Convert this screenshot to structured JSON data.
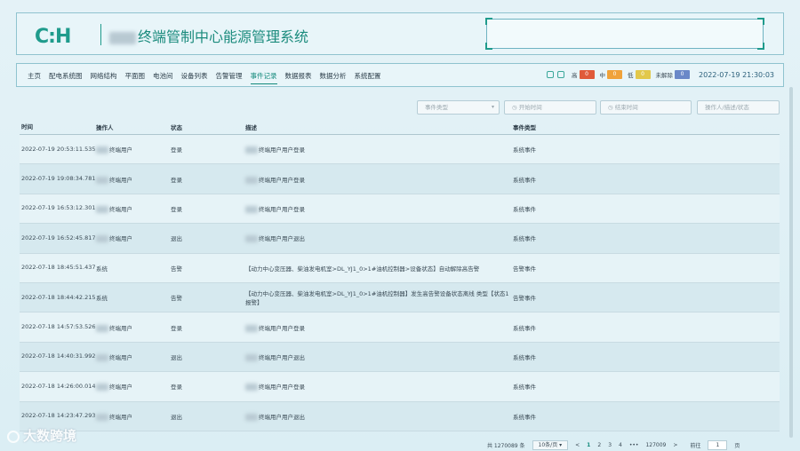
{
  "header": {
    "logo": "C:H",
    "title": "终端管制中心能源管理系统"
  },
  "nav": {
    "items": [
      "主页",
      "配电系统图",
      "网络结构",
      "平面图",
      "电池间",
      "设备列表",
      "告警管理",
      "事件记录",
      "数据报表",
      "数据分析",
      "系统配置"
    ],
    "active_index": 7
  },
  "status": {
    "levels": [
      {
        "label": "高",
        "count": "0",
        "color": "#e05a3a"
      },
      {
        "label": "中",
        "count": "0",
        "color": "#f0a23a"
      },
      {
        "label": "低",
        "count": "0",
        "color": "#e2c84a"
      },
      {
        "label": "未解除",
        "count": "0",
        "color": "#6a88c8"
      }
    ],
    "datetime": "2022-07-19 21:30:03"
  },
  "filters": {
    "event_type": "事件类型",
    "start_time": "开始时间",
    "end_time": "结束时间",
    "search": "操作人/描述/状态"
  },
  "table": {
    "headers": [
      "时间",
      "操作人",
      "状态",
      "描述",
      "事件类型"
    ],
    "rows": [
      {
        "time": "2022-07-19 20:53:11.535",
        "operator": "终端用户",
        "status": "登录",
        "desc": "终端用户用户登录",
        "type": "系统事件",
        "blur_op": true,
        "blur_desc": true
      },
      {
        "time": "2022-07-19 19:08:34.781",
        "operator": "终端用户",
        "status": "登录",
        "desc": "终端用户用户登录",
        "type": "系统事件",
        "blur_op": true,
        "blur_desc": true
      },
      {
        "time": "2022-07-19 16:53:12.301",
        "operator": "终端用户",
        "status": "登录",
        "desc": "终端用户用户登录",
        "type": "系统事件",
        "blur_op": true,
        "blur_desc": true
      },
      {
        "time": "2022-07-19 16:52:45.817",
        "operator": "终端用户",
        "status": "退出",
        "desc": "终端用户用户退出",
        "type": "系统事件",
        "blur_op": true,
        "blur_desc": true
      },
      {
        "time": "2022-07-18 18:45:51.437",
        "operator": "系统",
        "status": "告警",
        "desc": "【动力中心变压器、柴油发电机室>DL_YJ1_0>1#油机控制器>设备状态】自动解除高告警",
        "type": "告警事件",
        "blur_op": false,
        "blur_desc": false
      },
      {
        "time": "2022-07-18 18:44:42.215",
        "operator": "系统",
        "status": "告警",
        "desc": "【动力中心变压器、柴油发电机室>DL_YJ1_0>1#油机控制器】发生高告警设备状态离线 类型【状态1报警】",
        "type": "告警事件",
        "blur_op": false,
        "blur_desc": false
      },
      {
        "time": "2022-07-18 14:57:53.526",
        "operator": "终端用户",
        "status": "登录",
        "desc": "终端用户用户登录",
        "type": "系统事件",
        "blur_op": true,
        "blur_desc": true
      },
      {
        "time": "2022-07-18 14:40:31.992",
        "operator": "终端用户",
        "status": "退出",
        "desc": "终端用户用户退出",
        "type": "系统事件",
        "blur_op": true,
        "blur_desc": true
      },
      {
        "time": "2022-07-18 14:26:00.014",
        "operator": "终端用户",
        "status": "登录",
        "desc": "终端用户用户登录",
        "type": "系统事件",
        "blur_op": true,
        "blur_desc": true
      },
      {
        "time": "2022-07-18 14:23:47.293",
        "operator": "终端用户",
        "status": "退出",
        "desc": "终端用户用户退出",
        "type": "系统事件",
        "blur_op": true,
        "blur_desc": true
      }
    ]
  },
  "pagination": {
    "total": "共 1270089 条",
    "page_size": "10条/页",
    "prev": "<",
    "pages": [
      "1",
      "2",
      "3",
      "4"
    ],
    "ellipsis": "•••",
    "last": "127009",
    "next": ">",
    "goto_label": "前往",
    "goto_value": "1",
    "goto_suffix": "页"
  },
  "watermark": "大数跨境"
}
